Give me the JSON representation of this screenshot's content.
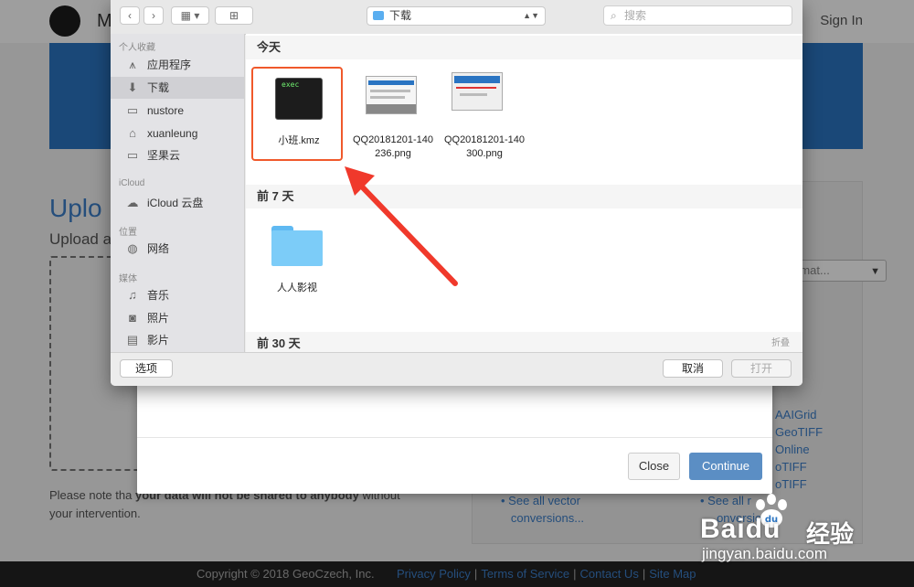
{
  "background_page": {
    "logo_letter": "M",
    "sign_in": "Sign In",
    "upload_title": "Uplo",
    "upload_sub": "Upload a",
    "note_prefix": "Please note tha",
    "note_bold": "your data will not be shared to anybody",
    "note_suffix": "without",
    "note_line2": "your intervention.",
    "format_select": "rmat...",
    "right_links": [
      "AAIGrid",
      "GeoTIFF",
      "Online",
      "oTIFF",
      "oTIFF"
    ],
    "see_all_vector": "See all vector",
    "conversions": "conversions...",
    "see_all_r": "See all r",
    "conversions_r": "onversio",
    "footer_copyright": "Copyright © 2018 GeoCzech, Inc.",
    "footer_links": [
      "Privacy Policy",
      "Terms of Service",
      "Contact Us",
      "Site Map"
    ]
  },
  "modal": {
    "close_label": "Close",
    "continue_label": "Continue"
  },
  "dialog": {
    "location": "下载",
    "search_placeholder": "搜索",
    "sidebar": {
      "favorites_header": "个人收藏",
      "favorites": [
        {
          "label": "应用程序",
          "icon": "apps-icon"
        },
        {
          "label": "下载",
          "icon": "download-icon",
          "selected": true
        },
        {
          "label": "nustore",
          "icon": "folder-icon"
        },
        {
          "label": "xuanleung",
          "icon": "home-icon"
        },
        {
          "label": "坚果云",
          "icon": "folder-icon"
        }
      ],
      "icloud_header": "iCloud",
      "icloud": [
        {
          "label": "iCloud 云盘",
          "icon": "cloud-icon"
        }
      ],
      "locations_header": "位置",
      "locations": [
        {
          "label": "网络",
          "icon": "globe-icon"
        }
      ],
      "media_header": "媒体",
      "media": [
        {
          "label": "音乐",
          "icon": "music-icon"
        },
        {
          "label": "照片",
          "icon": "camera-icon"
        },
        {
          "label": "影片",
          "icon": "film-icon"
        }
      ]
    },
    "sections": {
      "today": "今天",
      "last7": "前 7 天",
      "last30": "前 30 天",
      "collapse": "折叠"
    },
    "files_today": [
      {
        "name": "小班.kmz",
        "icon": "exec",
        "selected": true
      },
      {
        "name_line1": "QQ20181201-140",
        "name_line2": "236.png"
      },
      {
        "name_line1": "QQ20181201-140",
        "name_line2": "300.png"
      }
    ],
    "files_7": [
      {
        "name": "人人影视"
      }
    ],
    "options_label": "选项",
    "cancel_label": "取消",
    "open_label": "打开"
  },
  "watermark": {
    "brand": "Baidu",
    "cn": "经验",
    "url": "jingyan.baidu.com"
  },
  "colors": {
    "selection_border": "#f0592b",
    "arrow": "#f0392b",
    "accent_blue": "#2a74c2"
  }
}
